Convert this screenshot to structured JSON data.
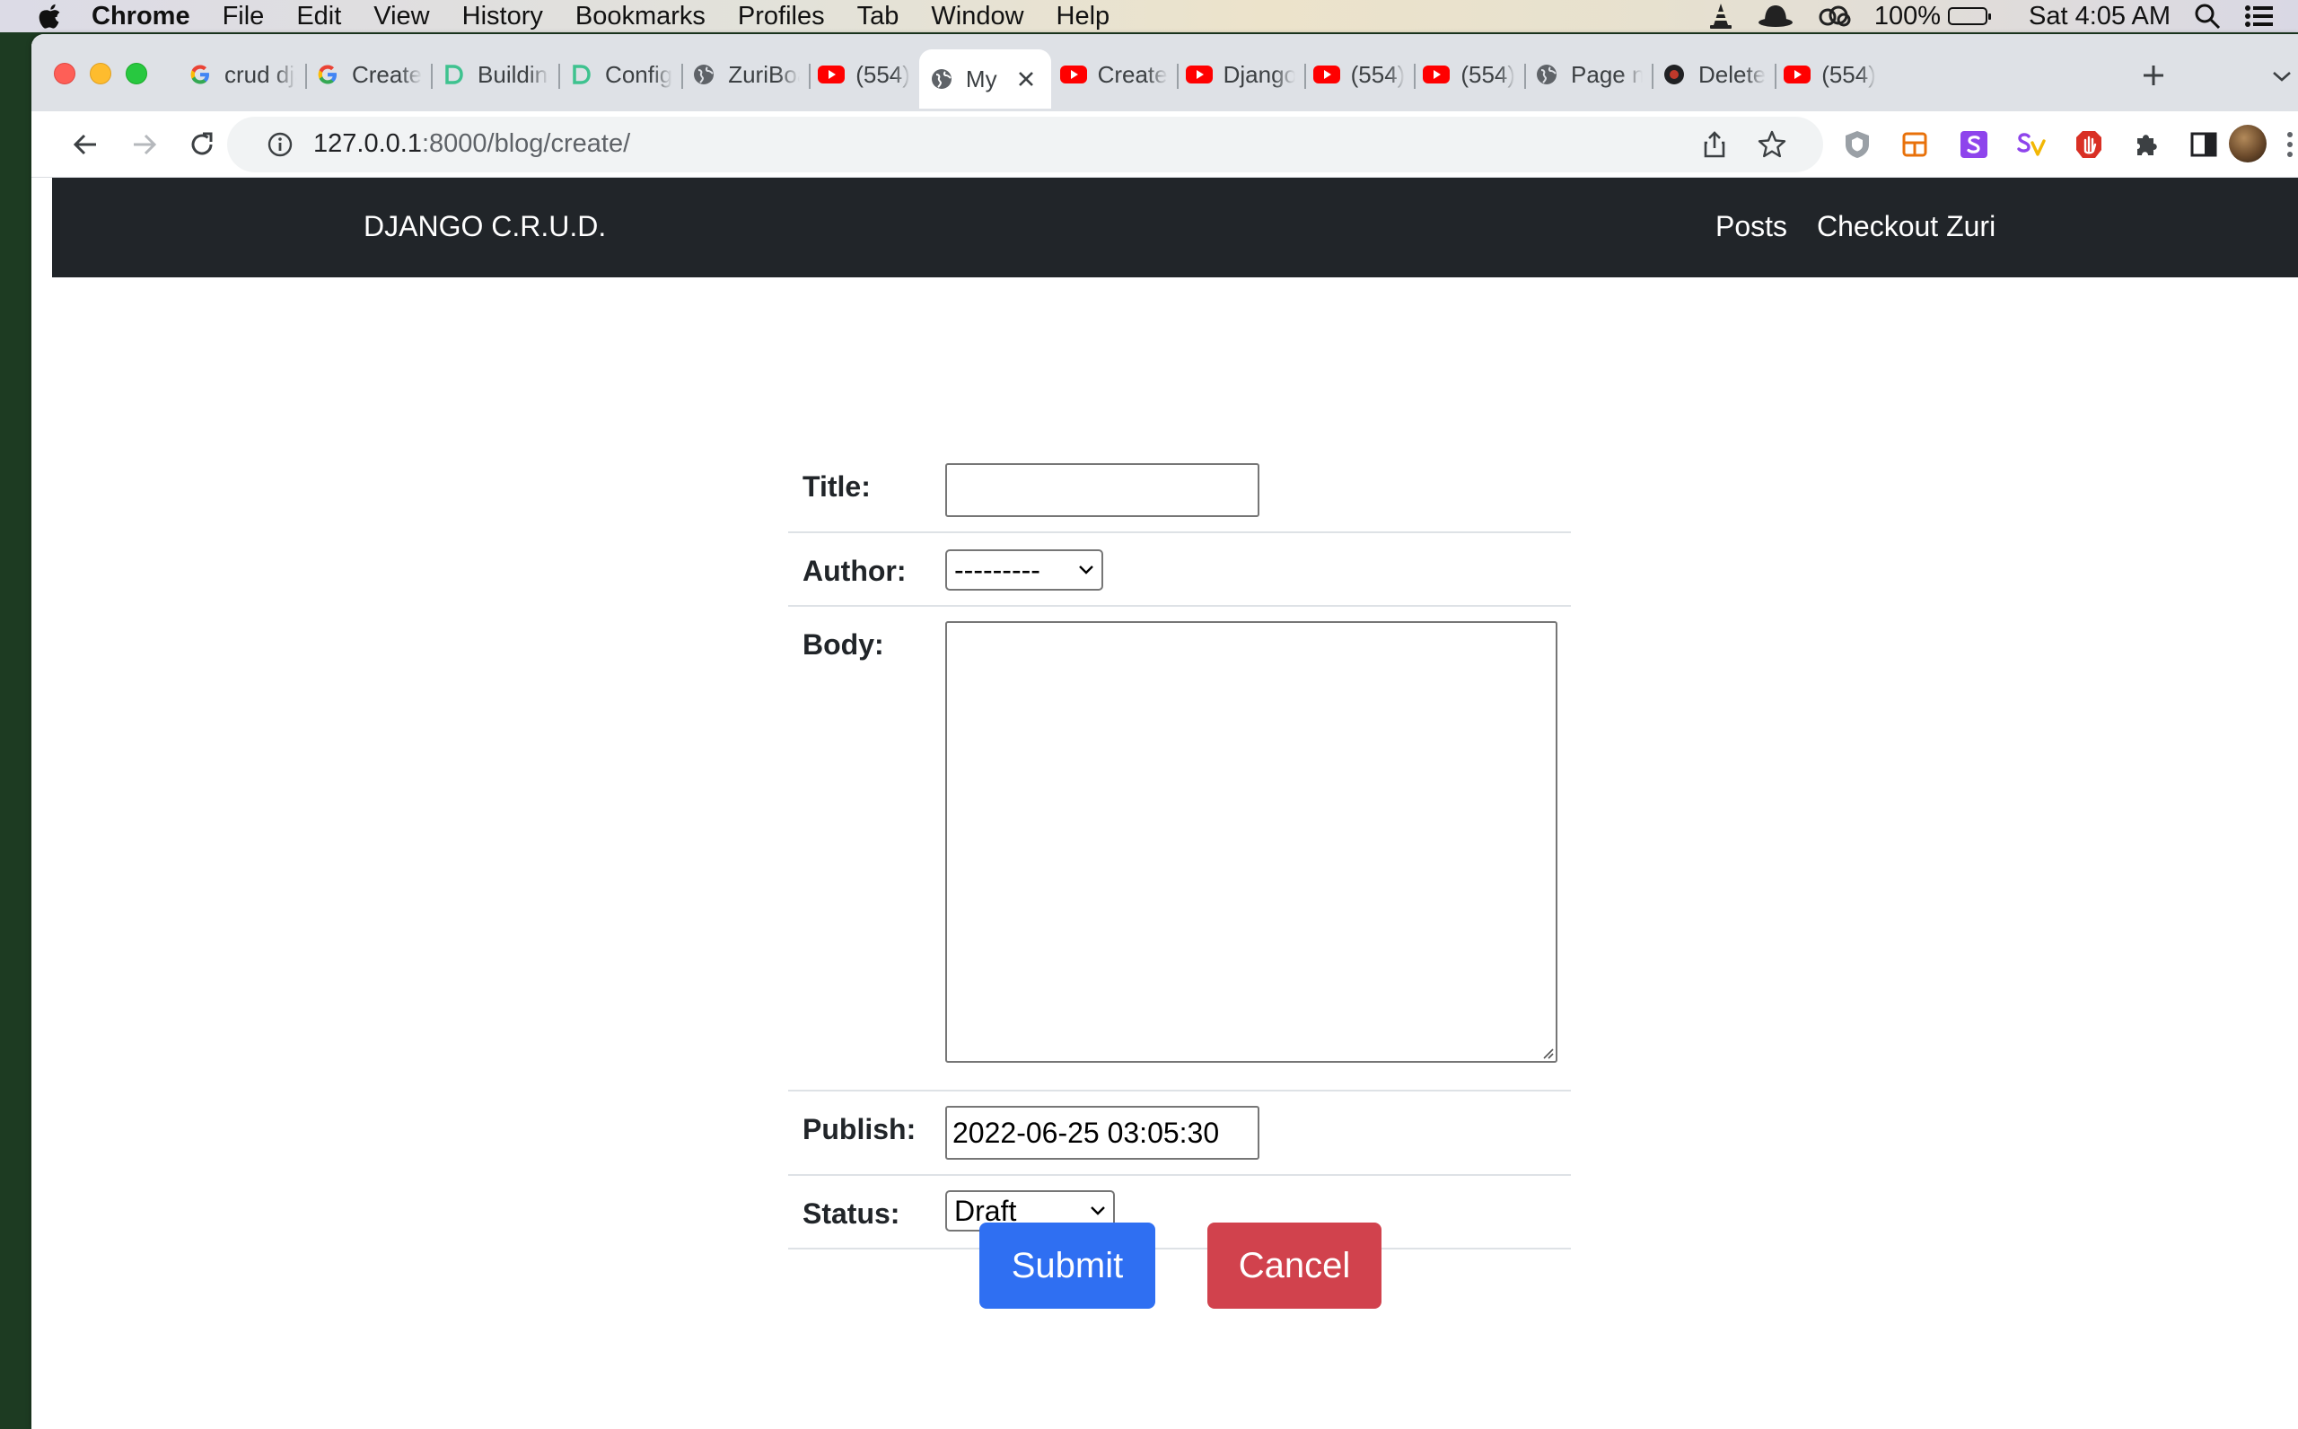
{
  "menubar": {
    "app": "Chrome",
    "items": [
      "File",
      "Edit",
      "View",
      "History",
      "Bookmarks",
      "Profiles",
      "Tab",
      "Window",
      "Help"
    ],
    "battery": "100%",
    "clock": "Sat 4:05 AM"
  },
  "tabs": [
    {
      "title": "crud django",
      "icon": "google-icon"
    },
    {
      "title": "Create",
      "icon": "google-icon"
    },
    {
      "title": "Building",
      "icon": "d-logo-icon"
    },
    {
      "title": "Config",
      "icon": "d-logo-icon"
    },
    {
      "title": "ZuriBoard",
      "icon": "globe-icon"
    },
    {
      "title": "(554)",
      "icon": "youtube-icon"
    },
    {
      "title": "My",
      "icon": "globe-icon",
      "active": true
    },
    {
      "title": "Create",
      "icon": "youtube-icon"
    },
    {
      "title": "Django",
      "icon": "youtube-icon"
    },
    {
      "title": "(554)",
      "icon": "youtube-icon"
    },
    {
      "title": "(554)",
      "icon": "youtube-icon"
    },
    {
      "title": "Page not",
      "icon": "globe-icon"
    },
    {
      "title": "Delete",
      "icon": "dark-circle-icon"
    },
    {
      "title": "(554)",
      "icon": "youtube-icon"
    }
  ],
  "address": {
    "host": "127.0.0.1",
    "rest": ":8000/blog/create/"
  },
  "extensions": [
    {
      "name": "shield-extension-icon",
      "color": "#8ab4f8"
    },
    {
      "name": "layout-extension-icon",
      "color": "#e8710a"
    },
    {
      "name": "s-extension-icon",
      "color": "#8e44ec",
      "letter": "S"
    },
    {
      "name": "sv-extension-icon",
      "color": "#8e44ec",
      "letter": "Sv"
    },
    {
      "name": "hand-extension-icon",
      "color": "#d93025"
    },
    {
      "name": "puzzle-extension-icon",
      "color": "#5f6368"
    },
    {
      "name": "side-panel-icon",
      "color": "#202124"
    }
  ],
  "site": {
    "brand": "DJANGO C.R.U.D.",
    "nav": [
      "Posts",
      "Checkout Zuri"
    ]
  },
  "form": {
    "title_label": "Title:",
    "title_value": "",
    "author_label": "Author:",
    "author_value": "---------",
    "body_label": "Body:",
    "body_value": "",
    "publish_label": "Publish:",
    "publish_value": "2022-06-25 03:05:30",
    "status_label": "Status:",
    "status_value": "Draft"
  },
  "buttons": {
    "submit": "Submit",
    "cancel": "Cancel"
  },
  "colors": {
    "navbar": "#212529",
    "submit": "#2f6ff2",
    "cancel": "#d1424d"
  }
}
